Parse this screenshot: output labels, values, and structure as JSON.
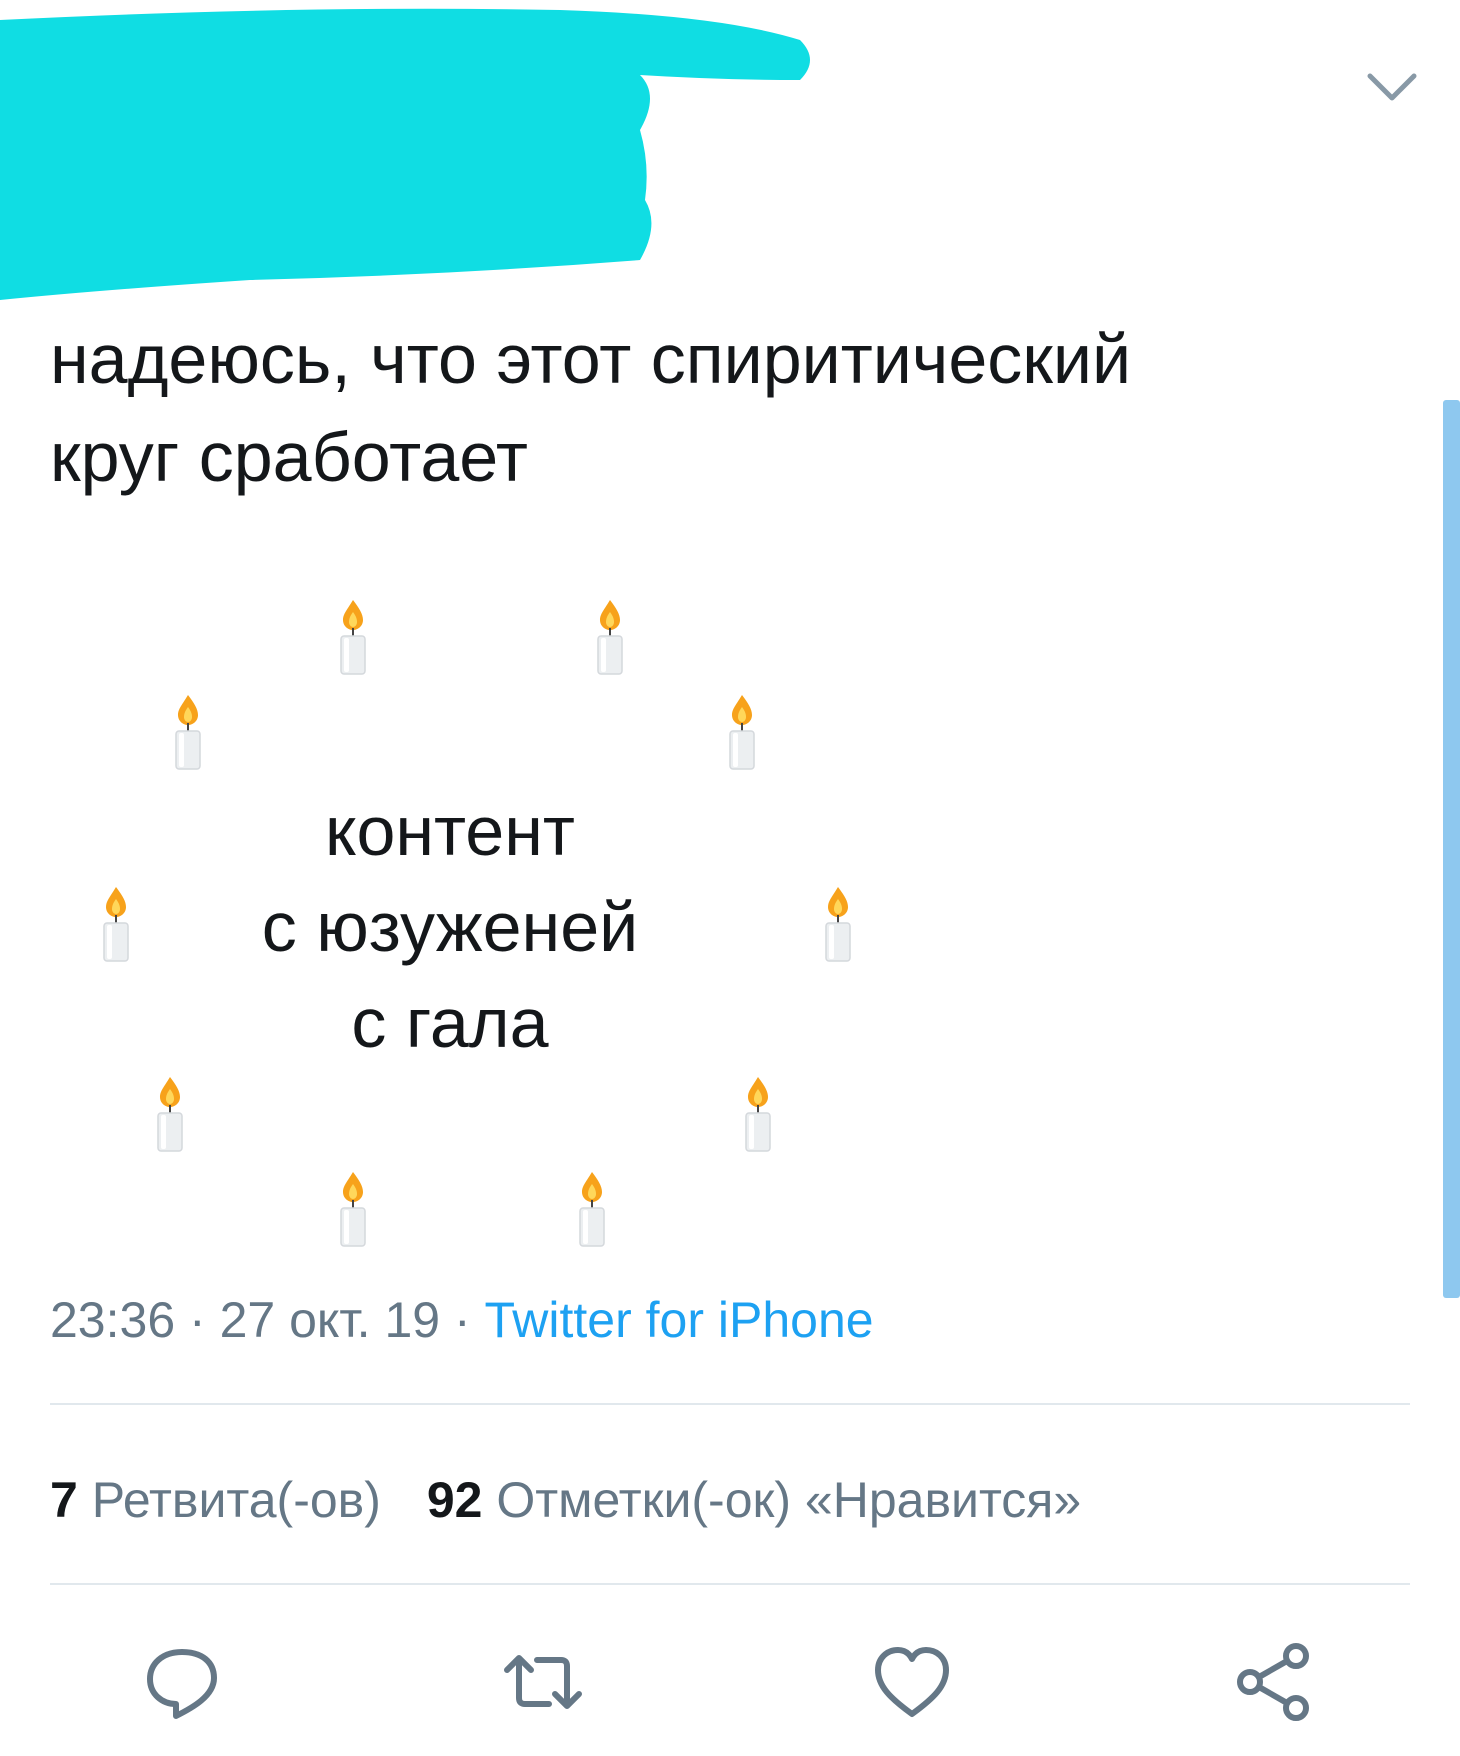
{
  "header": {
    "redaction_color": "#10dde3",
    "more_icon": "chevron-down-icon"
  },
  "tweet": {
    "text": "надеюсь, что этот спиритический\nкруг сработает",
    "circle_text": "контент\nс юзуженей\nс гала",
    "candle_count": 10,
    "time": "23:36",
    "sep1": " · ",
    "date": "27 окт. 19",
    "sep2": " · ",
    "source": "Twitter for iPhone"
  },
  "stats": {
    "retweets_count": "7",
    "retweets_label": " Ретвита(-ов)",
    "likes_count": "92",
    "likes_label": " Отметки(-ок) «Нравится»"
  },
  "actions": [
    "reply-icon",
    "retweet-icon",
    "like-icon",
    "share-icon"
  ],
  "colors": {
    "text": "#14171a",
    "muted": "#657786",
    "link": "#1da1f2",
    "icon": "#657786",
    "divider": "#e1e8ed"
  }
}
